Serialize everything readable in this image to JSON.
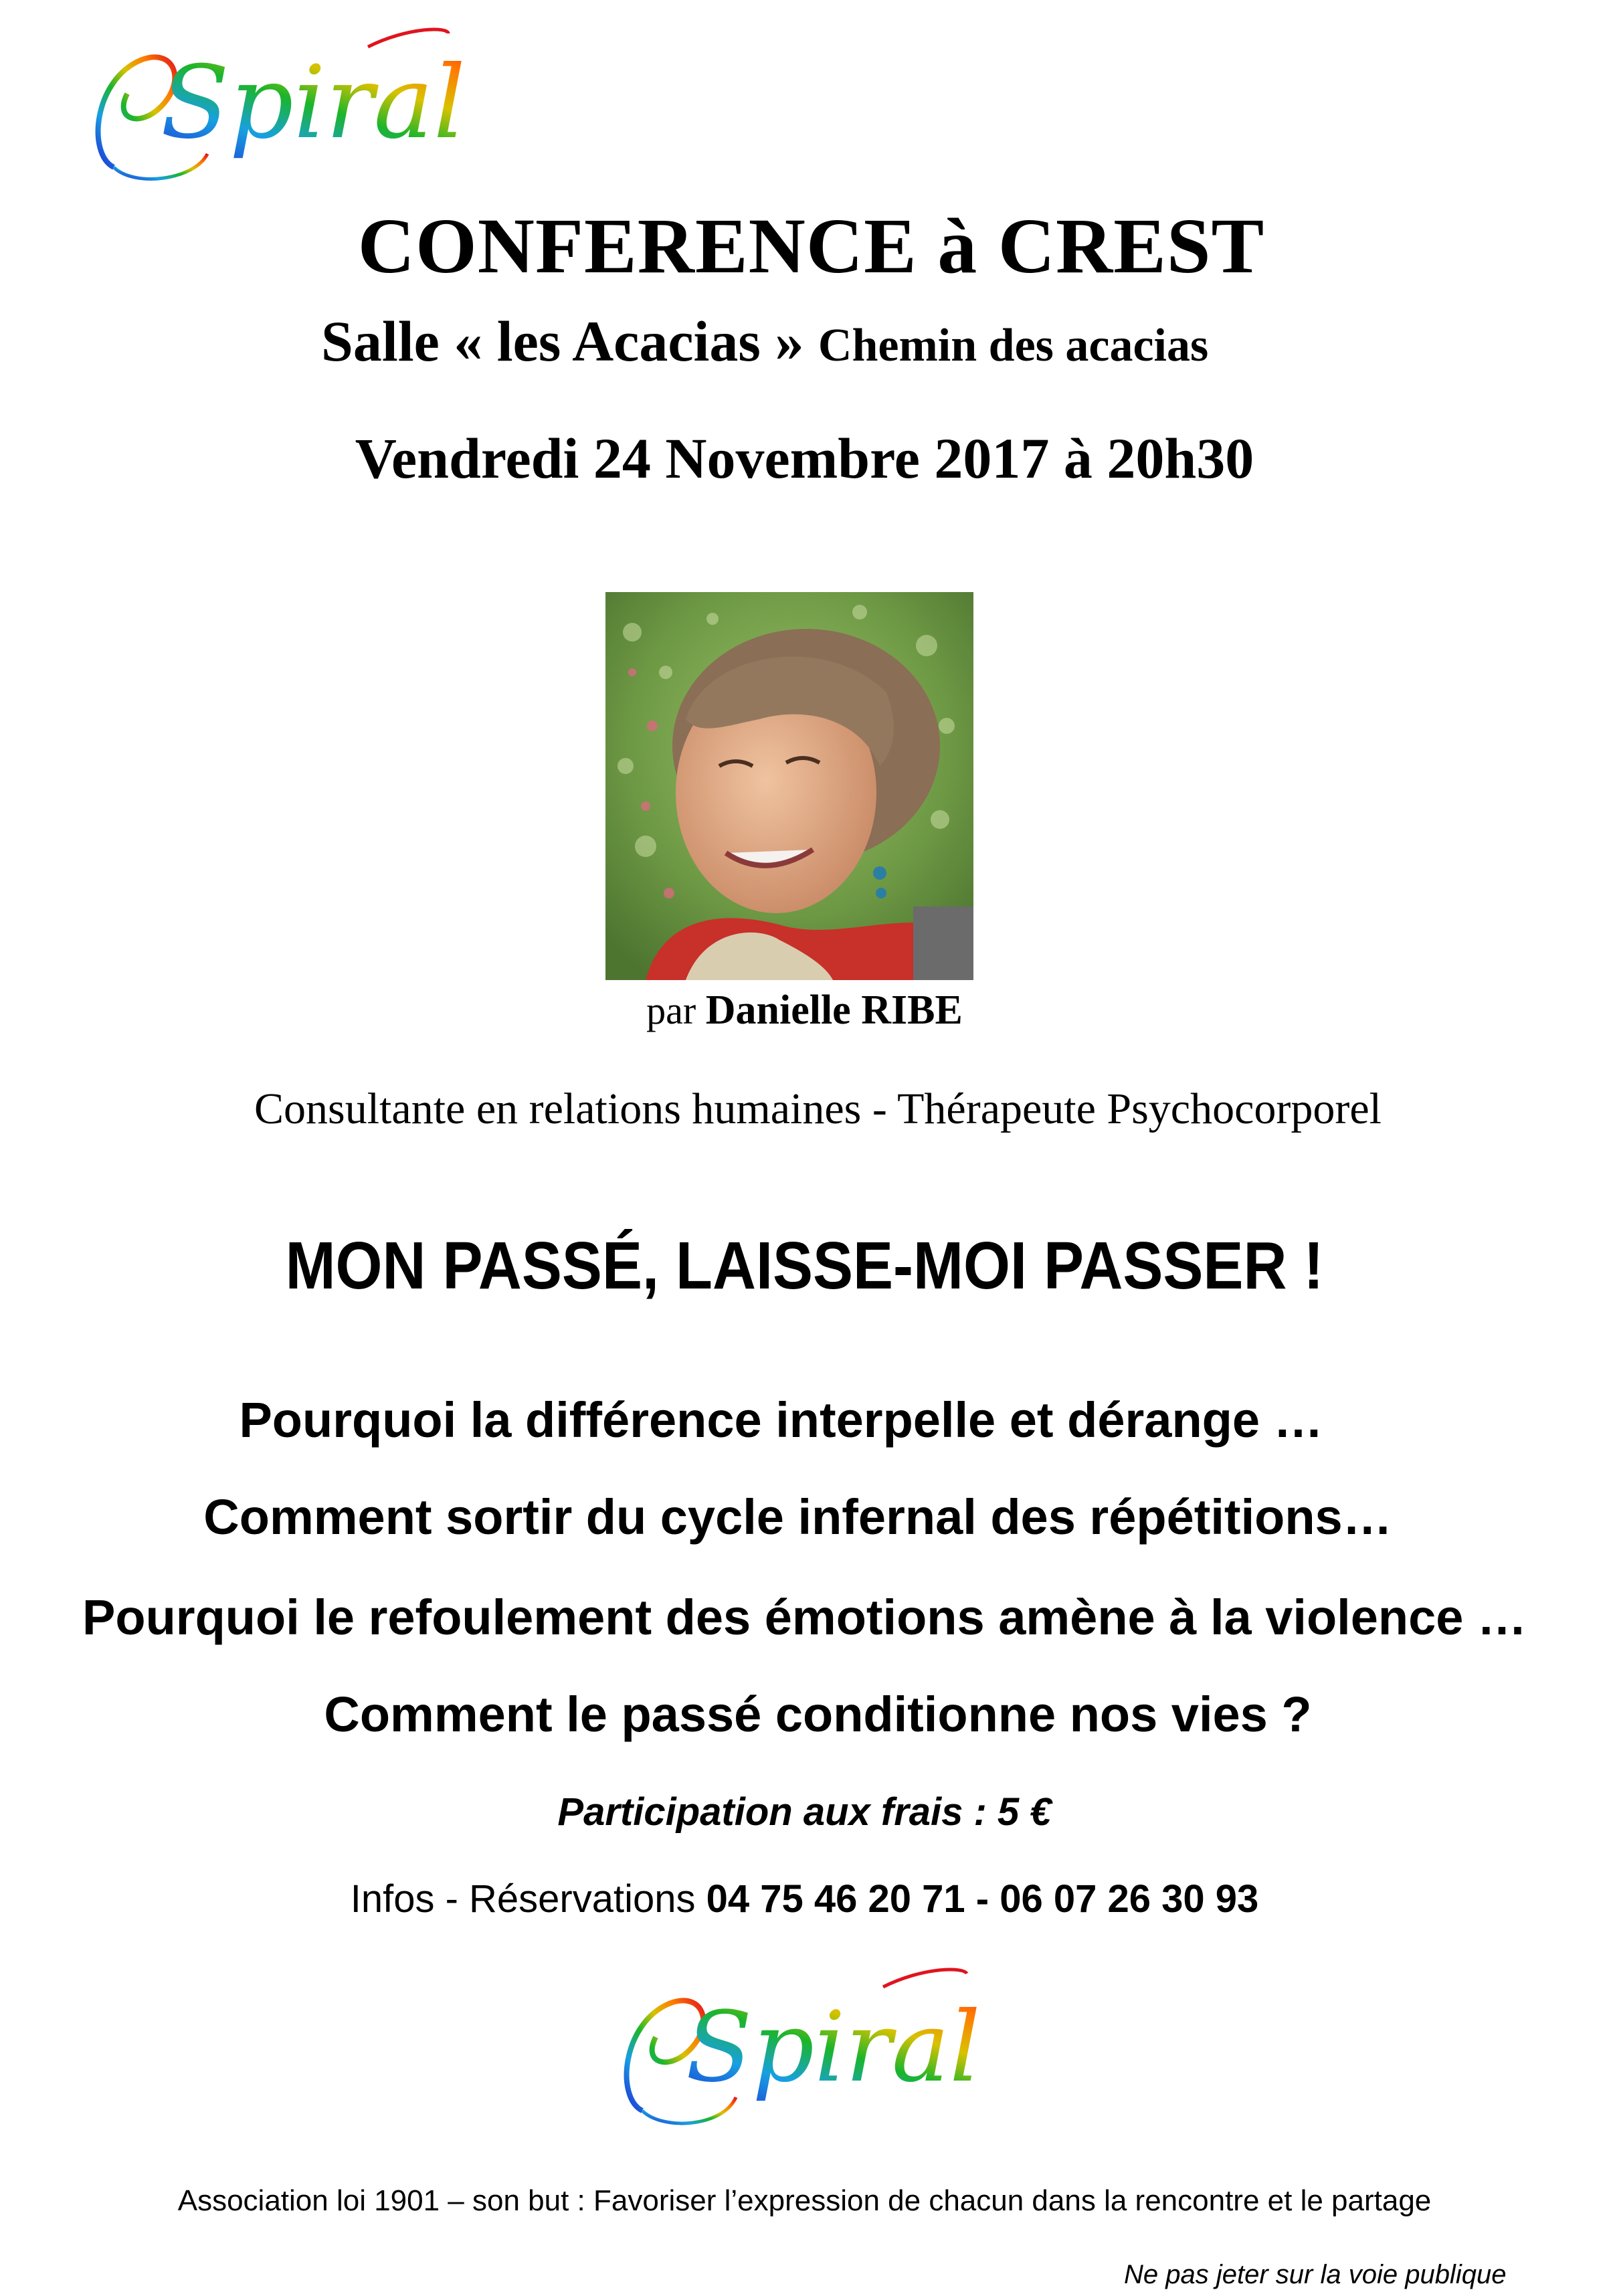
{
  "brand": {
    "logo_text": "Spirale",
    "logo_colors": [
      "#1f2fd6",
      "#18a0e0",
      "#1bb52a",
      "#d8c200",
      "#ff7a00",
      "#e0141e"
    ]
  },
  "event": {
    "title": "CONFERENCE à CREST",
    "venue_prefix": "Salle « les Acacias »",
    "venue_street": "Chemin des acacias",
    "datetime": "Vendredi 24 Novembre 2017 à 20h30"
  },
  "speaker": {
    "by": "par",
    "name": "Danielle RIBE",
    "role": "Consultante en relations humaines - Thérapeute Psychocorporel",
    "photo_icon": "portrait-photo"
  },
  "headline": "MON PASSÉ, LAISSE-MOI PASSER  !",
  "questions": [
    "Pourquoi la différence interpelle et dérange …",
    "Comment sortir du cycle infernal des répétitions…",
    "Pourquoi le refoulement des émotions amène à la violence …",
    "Comment le passé conditionne nos vies ?"
  ],
  "fee": "Participation aux frais : 5 €",
  "info": {
    "label": "Infos - Réservations",
    "phones": "04 75 46 20 71 - 06 07 26 30 93"
  },
  "association": "Association loi 1901 – son but : Favoriser l’expression de chacun dans la rencontre et le partage",
  "footnote": "Ne pas jeter sur la voie publique"
}
